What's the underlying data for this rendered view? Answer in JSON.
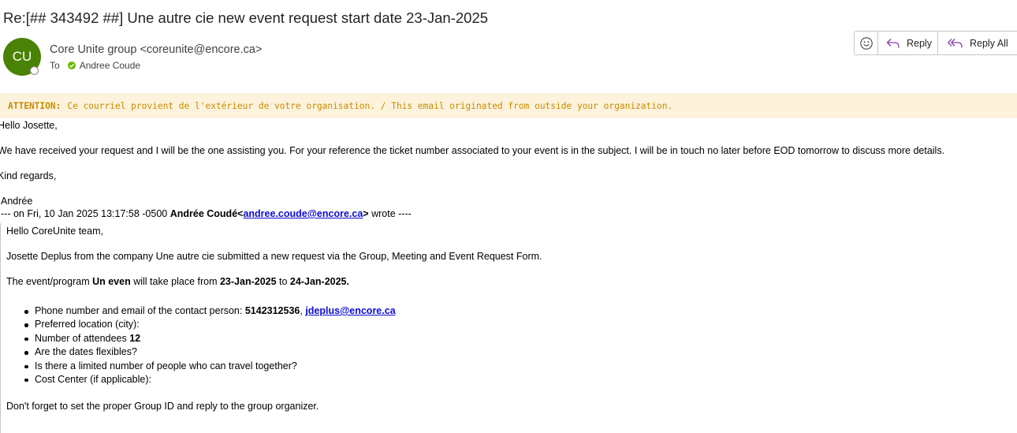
{
  "email": {
    "subject": "Re:[## 343492 ##] Une autre cie new event request start date 23-Jan-2025",
    "sender": {
      "initials": "CU",
      "display": "Core Unite group <coreunite@encore.ca>",
      "avatar_color": "#498205"
    },
    "to": {
      "label": "To",
      "recipient": "Andree Coude"
    }
  },
  "toolbar": {
    "emoji_icon": "smiley-icon",
    "reply_label": "Reply",
    "reply_all_label": "Reply All"
  },
  "banner": {
    "label": "ATTENTION:",
    "text": "Ce courriel provient de l'extérieur de votre organisation. / This email originated from outside your organization.",
    "bg_color": "#fdf3dc",
    "text_color": "#c88a00"
  },
  "body": {
    "greeting": "Hello Josette,",
    "paragraph": "We have received your request and I will be the one assisting you.  For your reference the ticket number associated to your event is in the subject.   I will be in touch no later before EOD tomorrow to discuss more details.",
    "regards": "Kind regards,",
    "signature": "Andrée"
  },
  "quoted": {
    "header_prefix": "--- on Fri, 10 Jan 2025 13:17:58 -0500 ",
    "author": "Andrée Coudé<",
    "author_email": "andree.coude@encore.ca",
    "header_suffix_bold": ">",
    "header_suffix": " wrote ----",
    "greeting": "Hello CoreUnite team,",
    "intro": "Josette Deplus from the company Une autre cie submitted a new request via the Group, Meeting and Event Request Form.",
    "event_p1": "The event/program ",
    "event_name": "Un even",
    "event_p2": " will take place from ",
    "start_date": "23-Jan-2025",
    "event_p3": " to ",
    "end_date": "24-Jan-2025.",
    "details": {
      "phone_label": "Phone number and email of the contact person: ",
      "phone": "5142312536",
      "phone_sep": ", ",
      "contact_email": "jdeplus@encore.ca",
      "location": "Preferred location (city):",
      "attendees_label": "Number of attendees ",
      "attendees": "12",
      "flexible": "Are the dates flexibles?",
      "limited": "Is there a limited number of people who can travel together?",
      "cost_center": "Cost Center (if applicable):"
    },
    "footer": "Don't forget to set the proper Group ID and reply to the group organizer."
  }
}
